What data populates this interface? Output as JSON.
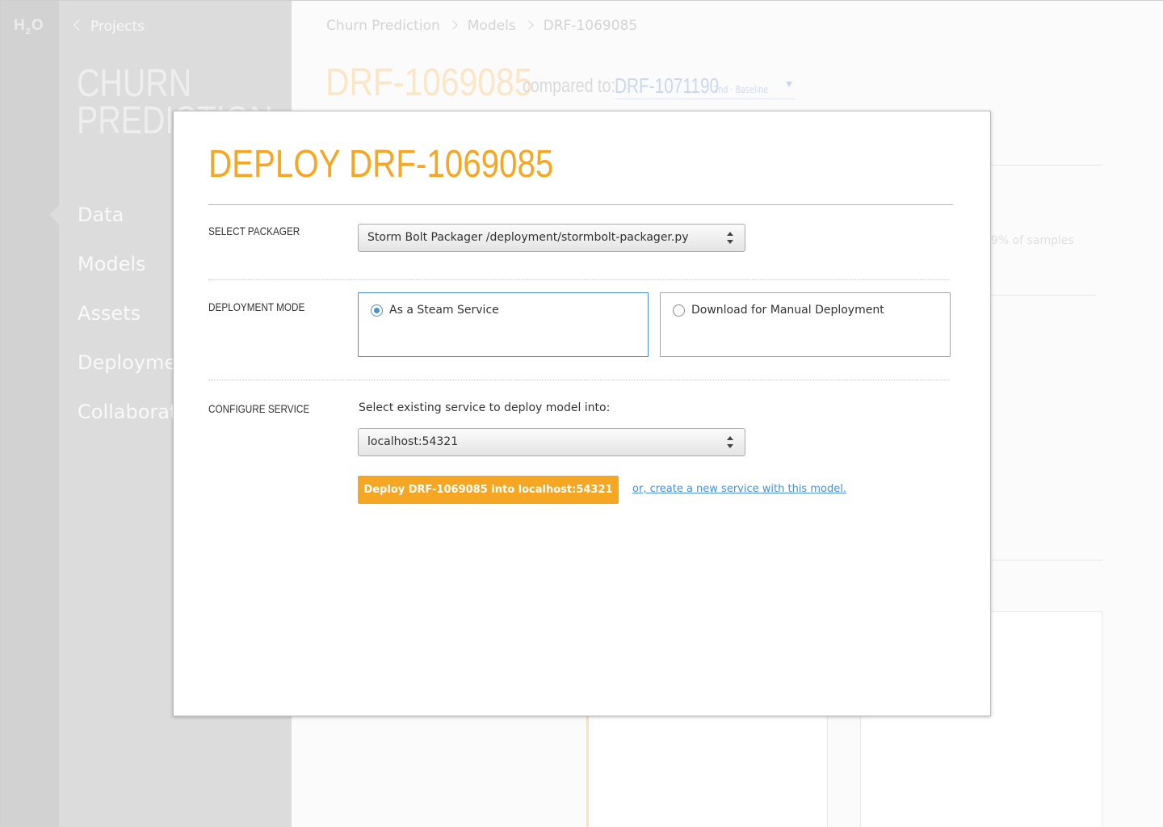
{
  "app": {
    "logo": "H2O",
    "back_label": "Projects",
    "project_name": "CHURN PREDICTION",
    "nav": [
      {
        "label": "Data"
      },
      {
        "label": "Models"
      },
      {
        "label": "Assets"
      },
      {
        "label": "Deployment"
      },
      {
        "label": "Collaborators"
      }
    ]
  },
  "header": {
    "breadcrumb": [
      "Churn Prediction",
      "Models",
      "DRF-1069085"
    ],
    "title": "DRF-1069085",
    "compared_label": "compared to:",
    "compared_value": "DRF-1071190",
    "compared_tag": "2nd · Baseline",
    "samples_text": "9% of samples"
  },
  "modal": {
    "title": "DEPLOY DRF-1069085",
    "packager": {
      "label": "SELECT PACKAGER",
      "value": "Storm Bolt Packager /deployment/stormbolt-packager.py"
    },
    "mode": {
      "label": "DEPLOYMENT MODE",
      "options": [
        {
          "label": "As a Steam Service",
          "selected": true
        },
        {
          "label": "Download for Manual Deployment",
          "selected": false
        }
      ]
    },
    "service": {
      "label": "CONFIGURE SERVICE",
      "prompt": "Select existing service to deploy model into:",
      "value": "localhost:54321",
      "deploy_label": "Deploy DRF-1069085 into localhost:54321",
      "create_link": "or, create a new service with this model."
    }
  },
  "colors": {
    "accent": "#f5a623",
    "link": "#4a90d9"
  }
}
